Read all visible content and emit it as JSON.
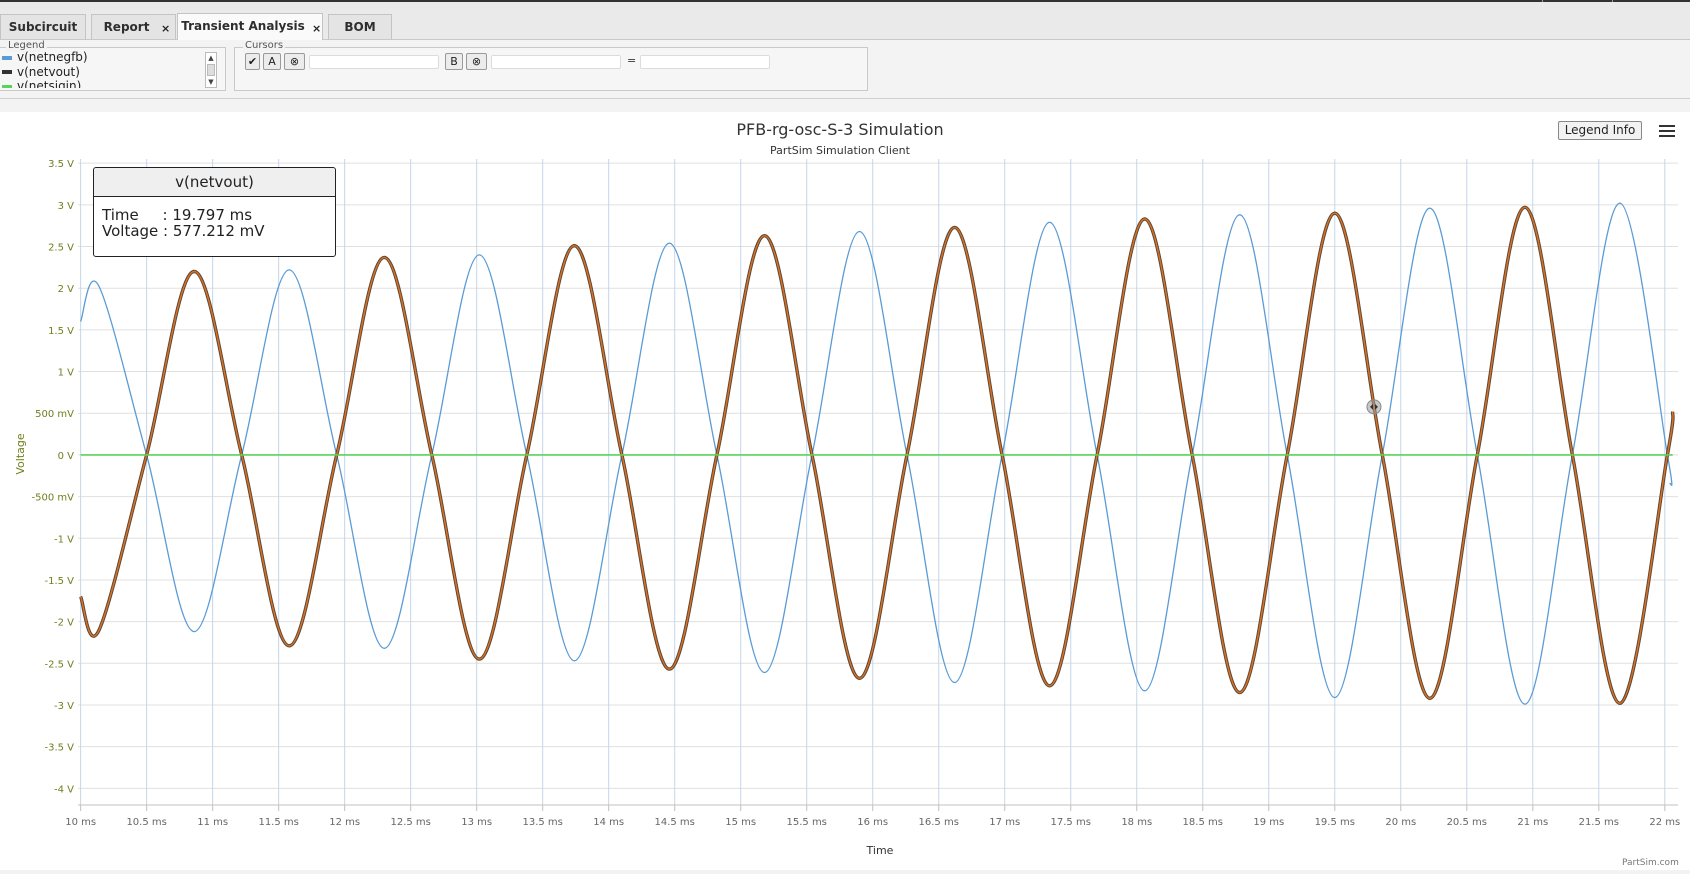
{
  "tabs": [
    {
      "label": "Subcircuit",
      "closable": false,
      "active": false
    },
    {
      "label": "Report",
      "closable": true,
      "active": false
    },
    {
      "label": "Transient Analysis",
      "closable": true,
      "active": true
    },
    {
      "label": "BOM",
      "closable": false,
      "active": false
    }
  ],
  "tab_close_glyph": "×",
  "legend_panel": {
    "title": "Legend",
    "items": [
      {
        "label": "v(netnegfb)",
        "color": "#5b9bd5"
      },
      {
        "label": "v(netvout)",
        "color": "#333333"
      },
      {
        "label": "v(netsigin)",
        "color": "#5ad35a"
      }
    ]
  },
  "cursors_panel": {
    "title": "Cursors",
    "checkbox_glyph": "✔",
    "cursor_a_label": "A",
    "cursor_b_label": "B",
    "clear_glyph": "⊗",
    "equals": "="
  },
  "chart": {
    "legend_info_label": "Legend Info",
    "credit": "PartSim.com",
    "tooltip": {
      "series": "v(netvout)",
      "time_row": "Time     : 19.797 ms",
      "voltage_row": "Voltage : 577.212 mV"
    }
  },
  "chart_data": {
    "type": "line",
    "title": "PFB-rg-osc-S-3 Simulation",
    "subtitle": "PartSim Simulation Client",
    "xlabel": "Time",
    "ylabel": "Voltage",
    "xlim": [
      9.98,
      22.1
    ],
    "ylim": [
      -4.2,
      3.55
    ],
    "x_ticks": [
      10,
      10.5,
      11,
      11.5,
      12,
      12.5,
      13,
      13.5,
      14,
      14.5,
      15,
      15.5,
      16,
      16.5,
      17,
      17.5,
      18,
      18.5,
      19,
      19.5,
      20,
      20.5,
      21,
      21.5,
      22
    ],
    "x_tick_labels": [
      "10 ms",
      "10.5 ms",
      "11 ms",
      "11.5 ms",
      "12 ms",
      "12.5 ms",
      "13 ms",
      "13.5 ms",
      "14 ms",
      "14.5 ms",
      "15 ms",
      "15.5 ms",
      "16 ms",
      "16.5 ms",
      "17 ms",
      "17.5 ms",
      "18 ms",
      "18.5 ms",
      "19 ms",
      "19.5 ms",
      "20 ms",
      "20.5 ms",
      "21 ms",
      "21.5 ms",
      "22 ms"
    ],
    "y_ticks": [
      3.5,
      3,
      2.5,
      2,
      1.5,
      1,
      0.5,
      0,
      -0.5,
      -1,
      -1.5,
      -2,
      -2.5,
      -3,
      -3.5,
      -4
    ],
    "y_tick_labels": [
      "3.5 V",
      "3 V",
      "2.5 V",
      "2 V",
      "1.5 V",
      "1 V",
      "500 mV",
      "0 V",
      "-500 mV",
      "-1 V",
      "-1.5 V",
      "-2 V",
      "-2.5 V",
      "-3 V",
      "-3.5 V",
      "-4 V"
    ],
    "grid": true,
    "colors": {
      "title": "#333333",
      "axis_text": "#6f7f1e",
      "grid": "#e0e0e0",
      "vgrid": "#c4d6ea"
    },
    "series": [
      {
        "name": "v(netnegfb)",
        "color": "#5b9bd5",
        "x": [
          10.0,
          10.14,
          10.5,
          10.86,
          11.22,
          11.58,
          11.94,
          12.3,
          12.66,
          13.02,
          13.38,
          13.74,
          14.1,
          14.46,
          14.82,
          15.18,
          15.54,
          15.9,
          16.26,
          16.62,
          16.98,
          17.34,
          17.7,
          18.06,
          18.42,
          18.78,
          19.14,
          19.5,
          19.86,
          20.22,
          20.58,
          20.94,
          21.3,
          21.66,
          22.02,
          22.04
        ],
        "y": [
          1.6,
          2.02,
          0.0,
          -2.12,
          0.0,
          2.22,
          0.0,
          -2.32,
          0.0,
          2.4,
          0.0,
          -2.47,
          0.0,
          2.54,
          0.0,
          -2.61,
          0.0,
          2.68,
          0.0,
          -2.73,
          0.0,
          2.79,
          0.0,
          -2.83,
          0.0,
          2.88,
          0.0,
          -2.91,
          0.0,
          2.96,
          0.0,
          -2.99,
          0.0,
          3.02,
          0.0,
          -0.35
        ]
      },
      {
        "name": "v(netvout)",
        "color": "#e07020",
        "x": [
          10.0,
          10.14,
          10.5,
          10.86,
          11.22,
          11.58,
          11.94,
          12.3,
          12.66,
          13.02,
          13.38,
          13.74,
          14.1,
          14.46,
          14.82,
          15.18,
          15.54,
          15.9,
          16.26,
          16.62,
          16.98,
          17.34,
          17.7,
          18.06,
          18.42,
          18.78,
          19.14,
          19.5,
          19.86,
          20.22,
          20.58,
          20.94,
          21.3,
          21.66,
          22.02,
          22.06
        ],
        "y": [
          -1.7,
          -2.1,
          0.0,
          2.2,
          0.0,
          -2.29,
          0.0,
          2.37,
          0.0,
          -2.45,
          0.0,
          2.51,
          0.0,
          -2.57,
          0.0,
          2.63,
          0.0,
          -2.68,
          0.0,
          2.73,
          0.0,
          -2.77,
          0.0,
          2.83,
          0.0,
          -2.85,
          0.0,
          2.9,
          0.0,
          -2.92,
          0.0,
          2.97,
          0.0,
          -2.98,
          0.0,
          0.52
        ]
      },
      {
        "name": "v(netsigin)",
        "color": "#5ad35a",
        "x": [
          10.0,
          22.06
        ],
        "y": [
          0.0,
          0.0
        ]
      }
    ],
    "cursor_marker": {
      "x": 19.797,
      "y": 0.577
    }
  }
}
